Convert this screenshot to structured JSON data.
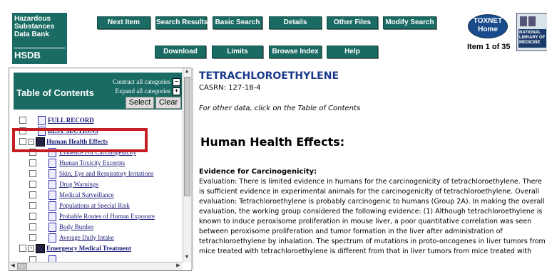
{
  "logo": {
    "lines": [
      "Hazardous",
      "Substances",
      "Data Bank"
    ],
    "short": "HSDB"
  },
  "nav": {
    "next_item": "Next Item",
    "search_results": "Search Results",
    "basic_search": "Basic Search",
    "details": "Details",
    "other_files": "Other Files",
    "modify_search": "Modify Search",
    "download": "Download",
    "limits": "Limits",
    "browse_index": "Browse Index",
    "help": "Help"
  },
  "toxnet": {
    "line1": "TOXNET",
    "line2": "Home"
  },
  "nlm": {
    "text": "NATIONAL LIBRARY OF MEDICINE"
  },
  "item_count": "Item 1 of 35",
  "toc": {
    "title": "Table of Contents",
    "contract": "Contract all categories",
    "expand": "Expand all categories",
    "select": "Select",
    "clear": "Clear",
    "items": [
      {
        "label": "FULL RECORD"
      },
      {
        "label": "BEST SECTIONS"
      },
      {
        "label": "Human Health Effects"
      },
      {
        "label": "Evidence For Carcinogenicity"
      },
      {
        "label": "Human Toxicity Excerpts"
      },
      {
        "label": "Skin, Eye and Respiratory Irritations"
      },
      {
        "label": "Drug Warnings"
      },
      {
        "label": "Medical Surveillance"
      },
      {
        "label": "Populations at Special Risk"
      },
      {
        "label": "Probable Routes of Human Exposure"
      },
      {
        "label": "Body Burden"
      },
      {
        "label": "Average Daily Intake"
      },
      {
        "label": "Emergency Medical Treatment"
      }
    ]
  },
  "content": {
    "title": "TETRACHLOROETHYLENE",
    "casrn": "CASRN: 127-18-4",
    "other_data": "For other data, click on the Table of Contents",
    "heading": "Human Health Effects:",
    "subheading": "Evidence for Carcinogenicity:",
    "paragraph": "Evaluation: There is limited evidence in humans for the carcinogenicity of tetrachloroethylene. There is sufficient evidence in experimental animals for the carcinogenicity of tetrachloroethylene. Overall evaluation: Tetrachloroethylene is probably carcinogenic to humans (Group 2A). In making the overall evaluation, the working group considered the following evidence: (1) Although tetrachloroethylene is known to induce peroxisome proliferation in mouse liver, a poor quantitative correlation was seen between peroxisome proliferation and tumor formation in the liver after administration of tetrachloroethylene by inhalation. The spectrum of mutations in proto-oncogenes in liver tumors from mice treated with tetrachloroethylene is different from that in liver tumors from mice treated with"
  },
  "colors": {
    "accent": "#1a6b63",
    "title_blue": "#1a3a8a",
    "highlight": "#c41e24",
    "link": "#1a1a7a"
  }
}
